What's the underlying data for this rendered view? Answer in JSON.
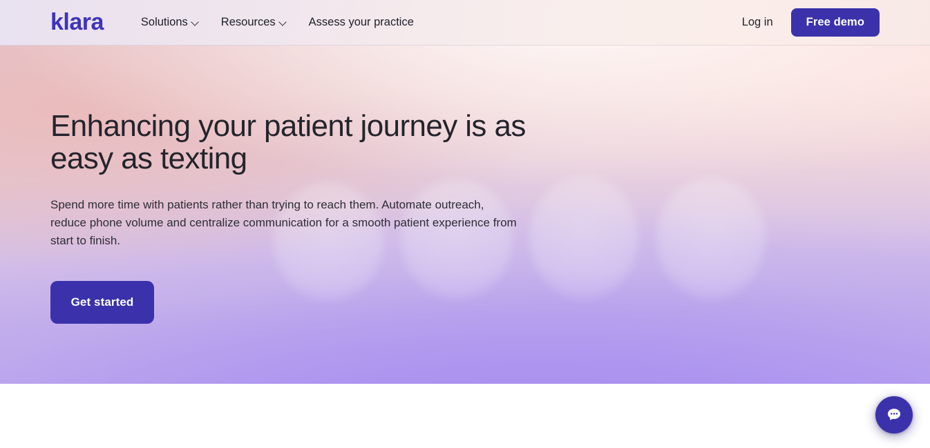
{
  "brand": {
    "logo_text": "klara",
    "primary_color": "#3b32ab",
    "logo_color": "#3f34b8"
  },
  "header": {
    "nav_items": [
      {
        "label": "Solutions",
        "has_dropdown": true,
        "icon": "chevron-down-icon"
      },
      {
        "label": "Resources",
        "has_dropdown": true,
        "icon": "chevron-down-icon"
      },
      {
        "label": "Assess your practice",
        "has_dropdown": false,
        "icon": ""
      }
    ],
    "login_label": "Log in",
    "demo_button_label": "Free demo"
  },
  "hero": {
    "title": "Enhancing your patient journey is as easy as texting",
    "subtitle": "Spend more time with patients rather than trying to reach them. Automate outreach, reduce phone volume and centralize communication for a smooth patient experience from start to finish.",
    "cta_label": "Get started"
  },
  "chat_widget": {
    "icon": "chat-bubble-icon",
    "color": "#3b32ab"
  }
}
